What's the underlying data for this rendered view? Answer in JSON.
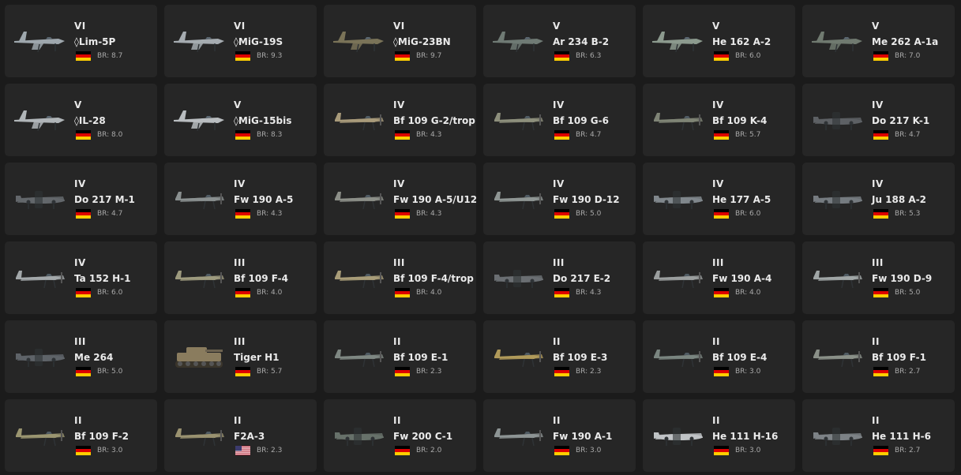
{
  "flags": {
    "germany": [
      "#000000",
      "#dd0000",
      "#ffce00"
    ]
  },
  "vehicles": [
    {
      "rank": "VI",
      "name": "◊Lim-5P",
      "br": "BR: 8.7",
      "country": "germany",
      "type": "jet",
      "tone": "#9ea7ad"
    },
    {
      "rank": "VI",
      "name": "◊MiG-19S",
      "br": "BR: 9.3",
      "country": "germany",
      "type": "jet",
      "tone": "#a5abb0"
    },
    {
      "rank": "VI",
      "name": "◊MiG-23BN",
      "br": "BR: 9.7",
      "country": "germany",
      "type": "jet",
      "tone": "#7a7358"
    },
    {
      "rank": "V",
      "name": "Ar 234 B-2",
      "br": "BR: 6.3",
      "country": "germany",
      "type": "jet",
      "tone": "#6f7a74"
    },
    {
      "rank": "V",
      "name": "He 162 A-2",
      "br": "BR: 6.0",
      "country": "germany",
      "type": "jet",
      "tone": "#8c9a8e"
    },
    {
      "rank": "V",
      "name": "Me 262 A-1a",
      "br": "BR: 7.0",
      "country": "germany",
      "type": "jet",
      "tone": "#707a70"
    },
    {
      "rank": "V",
      "name": "◊IL-28",
      "br": "BR: 8.0",
      "country": "germany",
      "type": "jet",
      "tone": "#b0b5b8"
    },
    {
      "rank": "V",
      "name": "◊MiG-15bis",
      "br": "BR: 8.3",
      "country": "germany",
      "type": "jet",
      "tone": "#b9bdc0"
    },
    {
      "rank": "IV",
      "name": "Bf 109 G-2/trop",
      "br": "BR: 4.3",
      "country": "germany",
      "type": "prop",
      "tone": "#a89a7a"
    },
    {
      "rank": "IV",
      "name": "Bf 109 G-6",
      "br": "BR: 4.7",
      "country": "germany",
      "type": "prop",
      "tone": "#8d8f7c"
    },
    {
      "rank": "IV",
      "name": "Bf 109 K-4",
      "br": "BR: 5.7",
      "country": "germany",
      "type": "prop",
      "tone": "#7f8476"
    },
    {
      "rank": "IV",
      "name": "Do 217 K-1",
      "br": "BR: 4.7",
      "country": "germany",
      "type": "bomber",
      "tone": "#5d6064"
    },
    {
      "rank": "IV",
      "name": "Do 217 M-1",
      "br": "BR: 4.7",
      "country": "germany",
      "type": "bomber",
      "tone": "#63676b"
    },
    {
      "rank": "IV",
      "name": "Fw 190 A-5",
      "br": "BR: 4.3",
      "country": "germany",
      "type": "prop",
      "tone": "#8a9090"
    },
    {
      "rank": "IV",
      "name": "Fw 190 A-5/U12",
      "br": "BR: 4.3",
      "country": "germany",
      "type": "prop",
      "tone": "#8c8f88"
    },
    {
      "rank": "IV",
      "name": "Fw 190 D-12",
      "br": "BR: 5.0",
      "country": "germany",
      "type": "prop",
      "tone": "#8f9694"
    },
    {
      "rank": "IV",
      "name": "He 177 A-5",
      "br": "BR: 6.0",
      "country": "germany",
      "type": "bomber",
      "tone": "#80878c"
    },
    {
      "rank": "IV",
      "name": "Ju 188 A-2",
      "br": "BR: 5.3",
      "country": "germany",
      "type": "bomber",
      "tone": "#767b80"
    },
    {
      "rank": "IV",
      "name": "Ta 152 H-1",
      "br": "BR: 6.0",
      "country": "germany",
      "type": "prop",
      "tone": "#a3a8aa"
    },
    {
      "rank": "III",
      "name": "Bf 109 F-4",
      "br": "BR: 4.0",
      "country": "germany",
      "type": "prop",
      "tone": "#9d9a7e"
    },
    {
      "rank": "III",
      "name": "Bf 109 F-4/trop",
      "br": "BR: 4.0",
      "country": "germany",
      "type": "prop",
      "tone": "#a89c78"
    },
    {
      "rank": "III",
      "name": "Do 217 E-2",
      "br": "BR: 4.3",
      "country": "germany",
      "type": "bomber",
      "tone": "#6a6e72"
    },
    {
      "rank": "III",
      "name": "Fw 190 A-4",
      "br": "BR: 4.0",
      "country": "germany",
      "type": "prop",
      "tone": "#9a9e9e"
    },
    {
      "rank": "III",
      "name": "Fw 190 D-9",
      "br": "BR: 5.0",
      "country": "germany",
      "type": "prop",
      "tone": "#a0a6a6"
    },
    {
      "rank": "III",
      "name": "Me 264",
      "br": "BR: 5.0",
      "country": "germany",
      "type": "bomber",
      "tone": "#5e6368"
    },
    {
      "rank": "III",
      "name": "Tiger H1",
      "br": "BR: 5.7",
      "country": "germany",
      "type": "tank",
      "tone": "#8a7c5e"
    },
    {
      "rank": "II",
      "name": "Bf 109 E-1",
      "br": "BR: 2.3",
      "country": "germany",
      "type": "prop",
      "tone": "#7e8782"
    },
    {
      "rank": "II",
      "name": "Bf 109 E-3",
      "br": "BR: 2.3",
      "country": "germany",
      "type": "prop",
      "tone": "#b09a5a"
    },
    {
      "rank": "II",
      "name": "Bf 109 E-4",
      "br": "BR: 3.0",
      "country": "germany",
      "type": "prop",
      "tone": "#7a8580"
    },
    {
      "rank": "II",
      "name": "Bf 109 F-1",
      "br": "BR: 2.7",
      "country": "germany",
      "type": "prop",
      "tone": "#8a9088"
    },
    {
      "rank": "II",
      "name": "Bf 109 F-2",
      "br": "BR: 3.0",
      "country": "germany",
      "type": "prop",
      "tone": "#9a9570"
    },
    {
      "rank": "II",
      "name": "F2A-3",
      "br": "BR: 2.3",
      "country": "usa",
      "type": "prop",
      "tone": "#9a9270"
    },
    {
      "rank": "II",
      "name": "Fw 200 C-1",
      "br": "BR: 2.0",
      "country": "germany",
      "type": "bomber",
      "tone": "#67716a"
    },
    {
      "rank": "II",
      "name": "Fw 190 A-1",
      "br": "BR: 3.0",
      "country": "germany",
      "type": "prop",
      "tone": "#8d9494"
    },
    {
      "rank": "II",
      "name": "He 111 H-16",
      "br": "BR: 3.0",
      "country": "germany",
      "type": "bomber",
      "tone": "#bfc3c5"
    },
    {
      "rank": "II",
      "name": "He 111 H-6",
      "br": "BR: 2.7",
      "country": "germany",
      "type": "bomber",
      "tone": "#7d8286"
    }
  ]
}
